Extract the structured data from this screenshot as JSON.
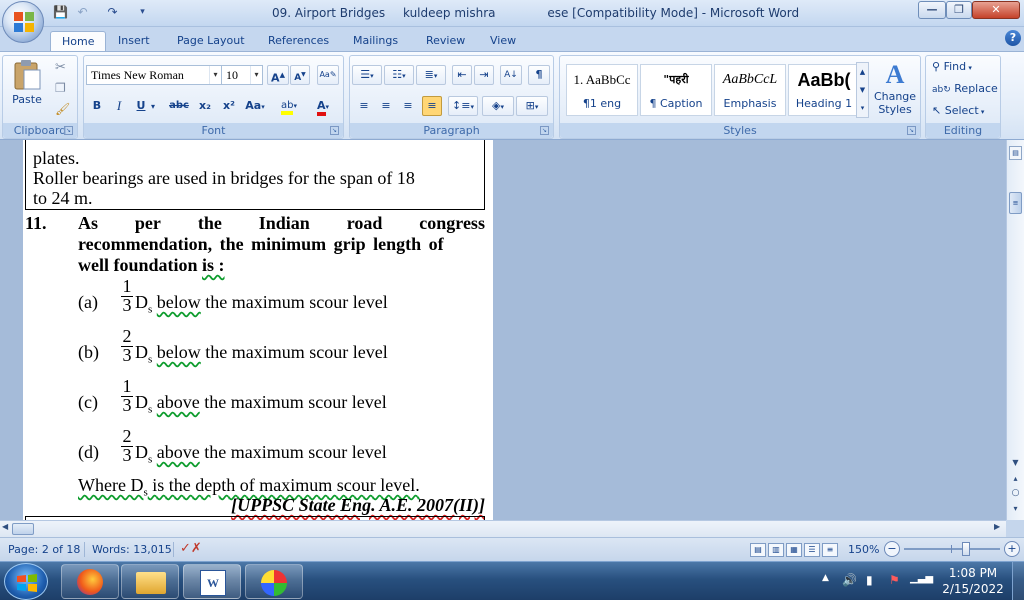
{
  "window": {
    "title_doc": "09. Airport Bridges",
    "title_user": "kuldeep mishra",
    "title_app": "ese [Compatibility Mode] - Microsoft Word",
    "minimize": "—",
    "maximize": "❐",
    "close": "✕"
  },
  "tabs": [
    "Home",
    "Insert",
    "Page Layout",
    "References",
    "Mailings",
    "Review",
    "View"
  ],
  "help": "?",
  "ribbon": {
    "clipboard": {
      "label": "Clipboard",
      "paste": "Paste"
    },
    "font": {
      "label": "Font",
      "family": "Times New Roman",
      "size": "10",
      "bold": "B",
      "italic": "I",
      "underline": "U",
      "strike": "abc",
      "sub": "x₂",
      "sup": "x²",
      "change_case": "Aa",
      "grow": "A",
      "shrink": "A",
      "highlight": "ab",
      "font_color": "A"
    },
    "paragraph": {
      "label": "Paragraph",
      "pilcrow": "¶",
      "sort": "A↓"
    },
    "styles": {
      "label": "Styles",
      "tiles": [
        {
          "preview": "1. AaBbCc",
          "name": "¶1 eng"
        },
        {
          "preview": "\"पहरी",
          "name": "¶ Caption"
        },
        {
          "preview": "AaBbCcL",
          "name": "Emphasis"
        },
        {
          "preview": "AaBb(",
          "name": "Heading 1"
        }
      ],
      "change_styles": "Change Styles"
    },
    "editing": {
      "label": "Editing",
      "find": "Find",
      "replace": "Replace",
      "select": "Select"
    }
  },
  "document": {
    "box_line1": "plates.",
    "box_line2": "Roller bearings are used in bridges for the span of 18",
    "box_line3": "to 24 m.",
    "q_number": "11.",
    "q_line1_words": [
      "As",
      "per",
      "the",
      "Indian",
      "road",
      "congress"
    ],
    "q_line2": "recommendation, the minimum grip length of",
    "q_line3a": "well foundation ",
    "q_line3b": "is :",
    "options": [
      {
        "label": "(a)",
        "num": "1",
        "den": "3",
        "var": "D",
        "sub": "s",
        "word": "below",
        "rest": " the maximum scour level"
      },
      {
        "label": "(b)",
        "num": "2",
        "den": "3",
        "var": "D",
        "sub": "s",
        "word": "below",
        "rest": " the maximum scour level"
      },
      {
        "label": "(c)",
        "num": "1",
        "den": "3",
        "var": "D",
        "sub": "s",
        "word": "above",
        "rest": " the maximum scour level"
      },
      {
        "label": "(d)",
        "num": "2",
        "den": "3",
        "var": "D",
        "sub": "s",
        "word": "above",
        "rest": " the maximum scour level"
      }
    ],
    "where_a": "Where D",
    "where_sub": "s",
    "where_b": " is the depth of maximum scour level.",
    "source": "[UPPSC State Eng. A.E. 2007(II)]"
  },
  "status": {
    "page": "Page: 2 of 18",
    "words": "Words: 13,015",
    "zoom": "150%",
    "zoom_level": 0.66
  },
  "taskbar": {
    "time": "1:08 PM",
    "date": "2/15/2022"
  }
}
